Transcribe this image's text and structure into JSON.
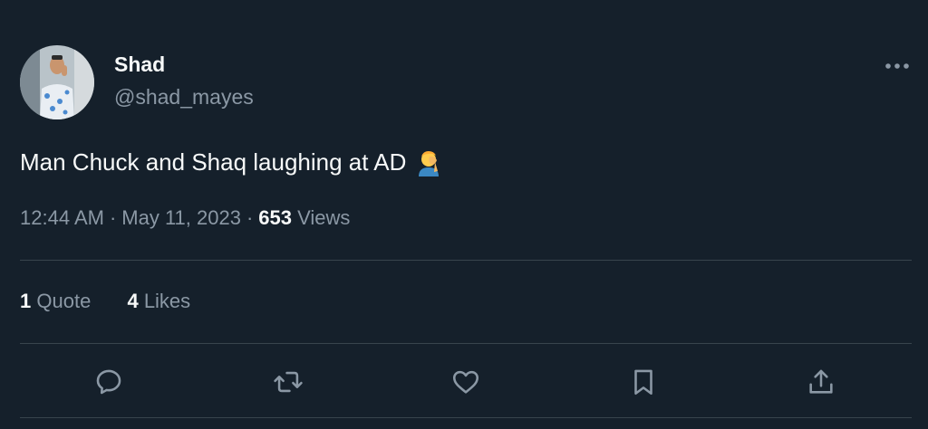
{
  "author": {
    "display_name": "Shad",
    "handle": "@shad_mayes",
    "avatar_icon": "profile-photo"
  },
  "tweet": {
    "text": "Man Chuck and Shaq laughing at AD",
    "emoji": "face-palm-emoji"
  },
  "meta": {
    "time": "12:44 AM",
    "date": "May 11, 2023",
    "separator": "·",
    "views_count": "653",
    "views_label": "Views"
  },
  "stats": {
    "quotes_count": "1",
    "quotes_label": "Quote",
    "likes_count": "4",
    "likes_label": "Likes"
  },
  "actions": {
    "reply_icon": "reply-icon",
    "retweet_icon": "retweet-icon",
    "like_icon": "heart-icon",
    "bookmark_icon": "bookmark-icon",
    "share_icon": "share-icon"
  },
  "colors": {
    "background": "#15202b",
    "primary_text": "#f7f9f9",
    "secondary_text": "#8b98a5",
    "divider": "#38444d"
  }
}
